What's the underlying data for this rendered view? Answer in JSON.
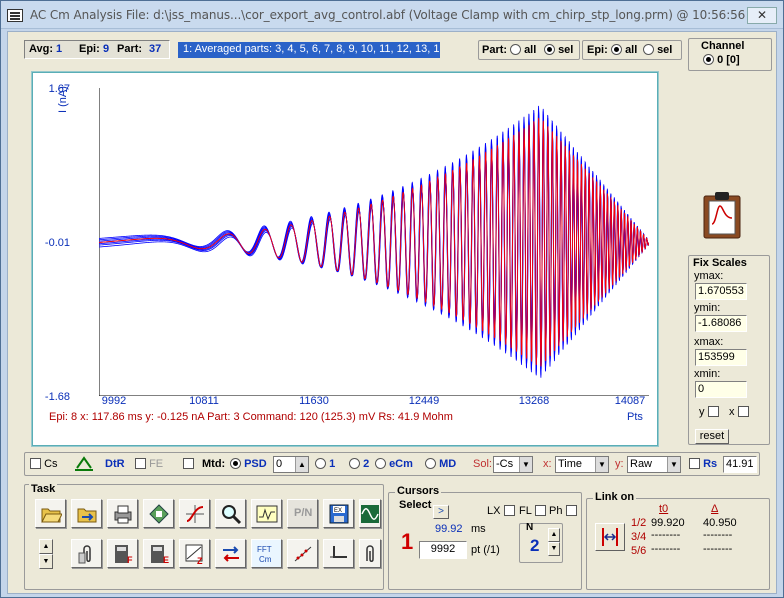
{
  "window": {
    "title": "AC Cm Analysis File: d:\\jss_manus...\\cor_export_avg_control.abf (Voltage Clamp with cm_chirp_stp_long.prm) @ 10:56:56 PM",
    "close_label": "✕"
  },
  "header": {
    "avg_label": "Avg:",
    "avg_value": "1",
    "epi_label": "Epi:",
    "epi_value": "9",
    "part_label": "Part:",
    "part_value": "37",
    "parts_list": "1: Averaged parts:  3, 4, 5, 6, 7, 8, 9, 10, 11, 12, 13, 1",
    "part_group_label": "Part:",
    "part_all": "all",
    "part_sel": "sel",
    "epi_group_label": "Epi:",
    "epi_all": "all",
    "epi_sel": "sel",
    "channel_title": "Channel",
    "channel_value": "0",
    "channel_index": "[0]"
  },
  "plot": {
    "y_axis_label": "I (nA)",
    "y_ticks": [
      "1.67",
      "-0.01",
      "-1.68"
    ],
    "x_ticks": [
      "9992",
      "10811",
      "11630",
      "12449",
      "13268",
      "14087"
    ],
    "x_unit": "Pts",
    "status_text": "Epi: 8  x: 117.86 ms   y: -0.125 nA  Part:  3  Command:  120 (125.3) mV  Rs: 41.9 Mohm"
  },
  "chart_data": {
    "type": "line",
    "title": "",
    "xlabel": "Pts",
    "ylabel": "I (nA)",
    "xlim": [
      9992,
      14087
    ],
    "ylim": [
      -1.68,
      1.67
    ],
    "series": [
      {
        "color": "#0000ff",
        "description_values": "multiple overlaid chirp current sweeps, amplitude rising to about ±1.4 nA near x≈13268 then decaying"
      },
      {
        "color": "#ff0000",
        "description_values": "averaged chirp current response"
      }
    ]
  },
  "fix_scales": {
    "title": "Fix Scales",
    "ymax_label": "ymax:",
    "ymax_value": "1.670553",
    "ymin_label": "ymin:",
    "ymin_value": "-1.68086",
    "xmax_label": "xmax:",
    "xmax_value": "153599",
    "xmin_label": "xmin:",
    "xmin_value": "0",
    "y_check_label": "y",
    "x_check_label": "x",
    "reset_label": "reset"
  },
  "options_bar": {
    "cs_label": "Cs",
    "dtr_label": "DtR",
    "fe_label": "FE",
    "mtd_label": "Mtd:",
    "psd_label": "PSD",
    "psd_value": "0",
    "radio_1": "1",
    "radio_2": "2",
    "ecm_label": "eCm",
    "md_label": "MD",
    "sol_label": "Sol:",
    "sol_value": "-Cs",
    "x_label": "x:",
    "x_value": "Time",
    "y_label": "y:",
    "y_value": "Raw",
    "rs_label": "Rs",
    "rs_value": "41.91"
  },
  "task": {
    "title": "Task",
    "pn_label": "P/N"
  },
  "cursors": {
    "title": "Cursors",
    "select_label": "Select",
    "select_button": ">",
    "lx_label": "LX",
    "fl_label": "FL",
    "ph_label": "Ph",
    "cursor_number": "1",
    "time_value": "99.92",
    "time_unit": "ms",
    "pt_value": "9992",
    "pt_unit": "pt (/1)",
    "n_label": "N",
    "n_value": "2"
  },
  "link_on": {
    "title": "Link on",
    "t0_header": "t0",
    "delta_header": "Δ",
    "rows": [
      {
        "label": "1/2",
        "t0": "99.920",
        "delta": "40.950"
      },
      {
        "label": "3/4",
        "t0": "--------",
        "delta": "--------"
      },
      {
        "label": "5/6",
        "t0": "--------",
        "delta": "--------"
      }
    ]
  }
}
